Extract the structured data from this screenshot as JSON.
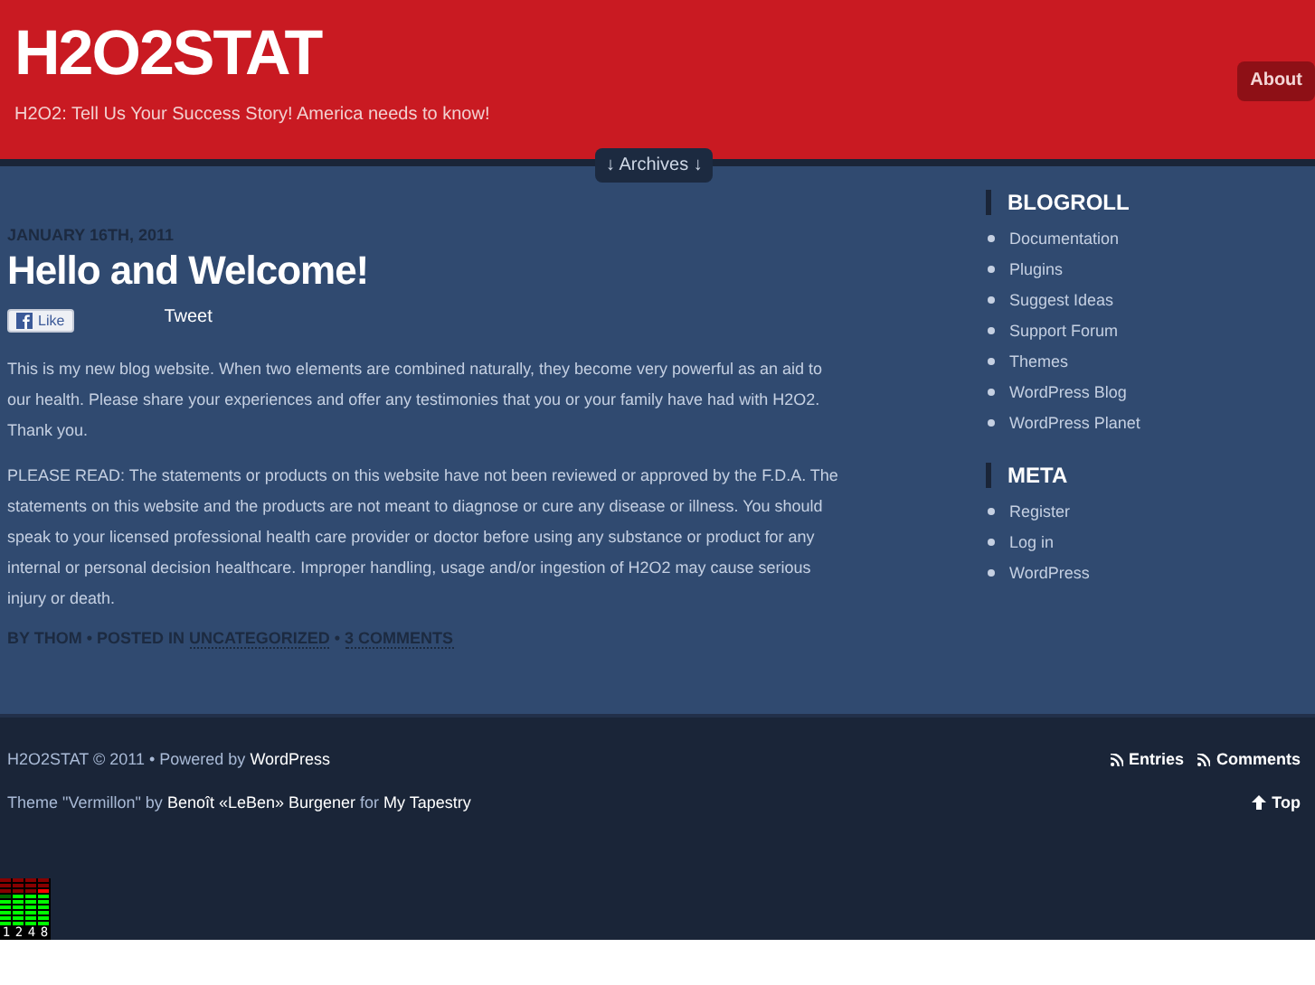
{
  "header": {
    "title": "H2O2STAT",
    "tagline": "H2O2: Tell Us Your Success Story! America needs to know!",
    "nav": [
      {
        "label": "About"
      }
    ],
    "archives": "↓ Archives ↓"
  },
  "post": {
    "date": "JANUARY 16TH, 2011",
    "title": "Hello and Welcome!",
    "like": "Like",
    "tweet": "Tweet",
    "paragraphs": [
      "This is my new blog website. When two elements are combined naturally, they become very powerful as an aid to our health. Please share your experiences and offer any testimonies that you or your family have had with H2O2. Thank you.",
      "PLEASE READ: The statements or products on this website have not been reviewed or approved by the F.D.A. The statements on this website and the products are not meant to diagnose or cure any disease or illness. You should speak to your licensed professional health care provider or doctor before using any substance or product for any internal or personal decision healthcare. Improper handling, usage and/or ingestion of H2O2 may cause serious injury or death."
    ],
    "meta": [
      {
        "kind": "text",
        "text": "BY THOM • POSTED IN "
      },
      {
        "kind": "link",
        "text": "UNCATEGORIZED"
      },
      {
        "kind": "text",
        "text": " • "
      },
      {
        "kind": "link",
        "text": "3 COMMENTS"
      }
    ]
  },
  "sidebar": [
    {
      "title": "BLOGROLL",
      "items": [
        "Documentation",
        "Plugins",
        "Suggest Ideas",
        "Support Forum",
        "Themes",
        "WordPress Blog",
        "WordPress Planet"
      ]
    },
    {
      "title": "META",
      "items": [
        "Register",
        "Log in",
        "WordPress"
      ]
    }
  ],
  "footer": {
    "lines": [
      [
        {
          "kind": "text",
          "text": "H2O2STAT © 2011 • Powered by "
        },
        {
          "kind": "link",
          "text": "WordPress"
        }
      ],
      [
        {
          "kind": "text",
          "text": "Theme \"Vermillon\" by "
        },
        {
          "kind": "link",
          "text": "Benoît «LeBen» Burgener"
        },
        {
          "kind": "text",
          "text": " for "
        },
        {
          "kind": "link",
          "text": "My Tapestry"
        }
      ]
    ],
    "feeds": [
      "Entries",
      "Comments"
    ],
    "top": "Top"
  },
  "meter": {
    "labels": [
      "1",
      "2",
      "4",
      "8"
    ]
  }
}
